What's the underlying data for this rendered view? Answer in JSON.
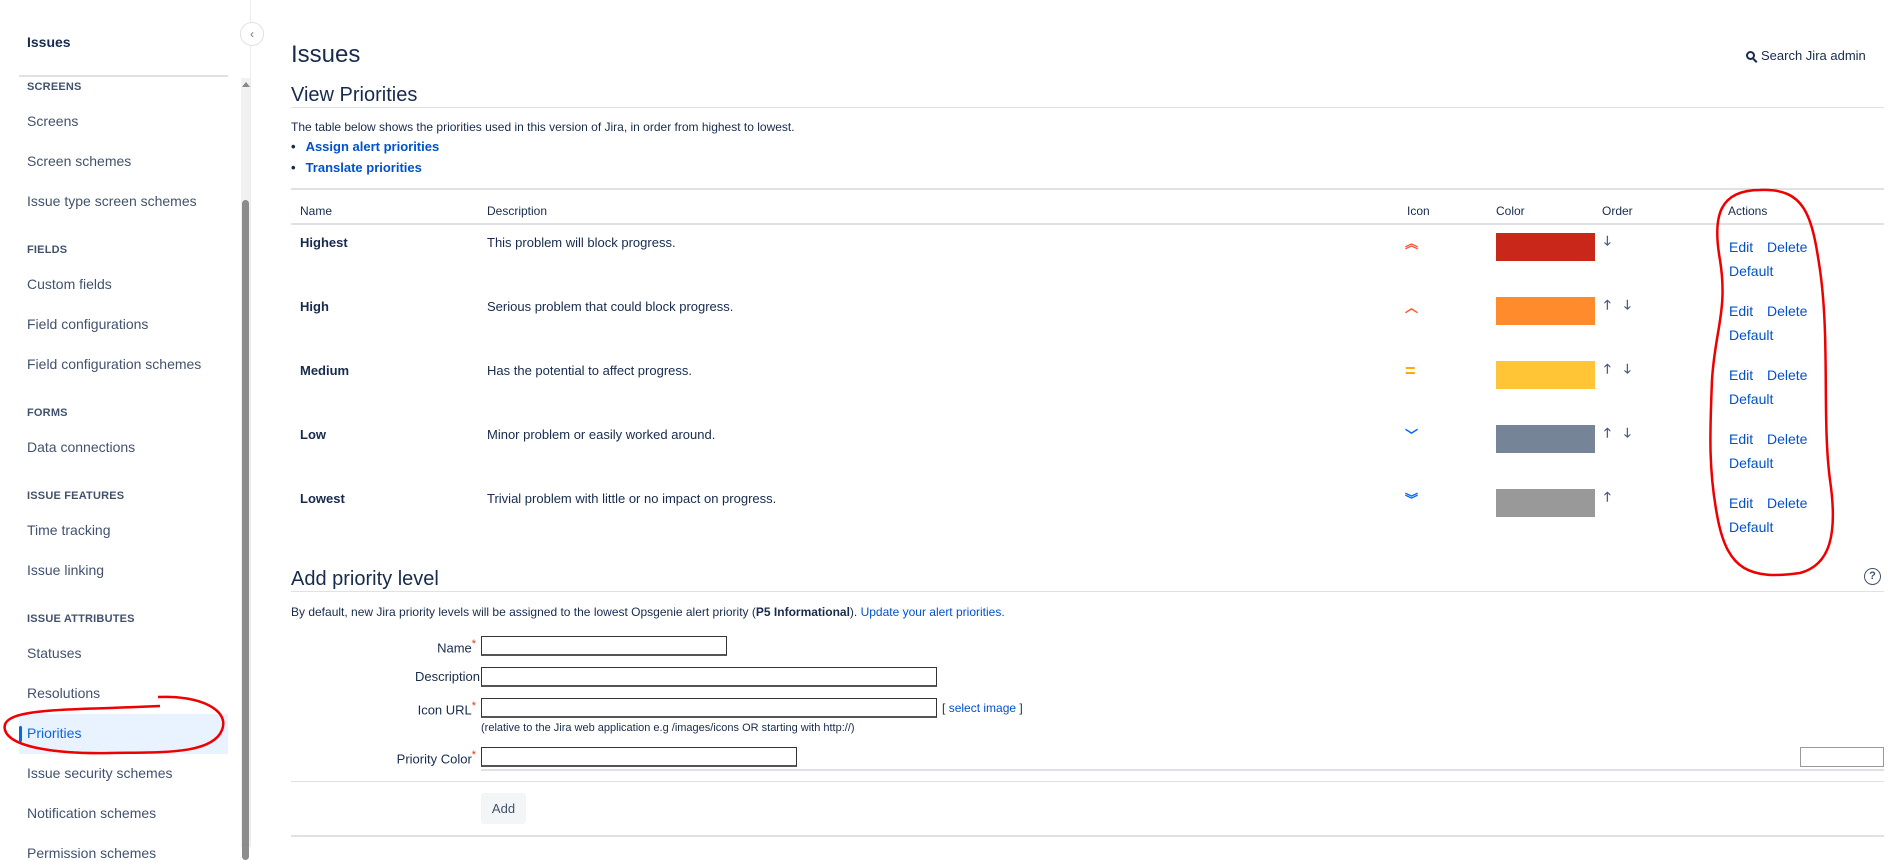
{
  "sidebar": {
    "title": "Issues",
    "sections": [
      {
        "heading": "SCREENS",
        "items": [
          "Screens",
          "Screen schemes",
          "Issue type screen schemes"
        ]
      },
      {
        "heading": "FIELDS",
        "items": [
          "Custom fields",
          "Field configurations",
          "Field configuration schemes"
        ]
      },
      {
        "heading": "FORMS",
        "items": [
          "Data connections"
        ]
      },
      {
        "heading": "ISSUE FEATURES",
        "items": [
          "Time tracking",
          "Issue linking"
        ]
      },
      {
        "heading": "ISSUE ATTRIBUTES",
        "items": [
          "Statuses",
          "Resolutions",
          "Priorities",
          "Issue security schemes",
          "Notification schemes",
          "Permission schemes"
        ]
      }
    ],
    "active": "Priorities"
  },
  "header": {
    "title": "Issues",
    "search_label": "Search Jira admin"
  },
  "view": {
    "title": "View Priorities",
    "intro": "The table below shows the priorities used in this version of Jira, in order from highest to lowest.",
    "links": [
      "Assign alert priorities",
      "Translate priorities"
    ],
    "columns": [
      "Name",
      "Description",
      "Icon",
      "Color",
      "Order",
      "Actions"
    ],
    "rows": [
      {
        "name": "Highest",
        "description": "This problem will block progress.",
        "icon": "double-chevron-up",
        "icon_color": "#ff5630",
        "color": "#c9271a",
        "up": false,
        "down": true
      },
      {
        "name": "High",
        "description": "Serious problem that could block progress.",
        "icon": "chevron-up",
        "icon_color": "#ff5630",
        "color": "#ff8b2d",
        "up": true,
        "down": true
      },
      {
        "name": "Medium",
        "description": "Has the potential to affect progress.",
        "icon": "equals",
        "icon_color": "#ffab00",
        "color": "#ffc536",
        "up": true,
        "down": true
      },
      {
        "name": "Low",
        "description": "Minor problem or easily worked around.",
        "icon": "chevron-down",
        "icon_color": "#0065ff",
        "color": "#768497",
        "up": true,
        "down": true
      },
      {
        "name": "Lowest",
        "description": "Trivial problem with little or no impact on progress.",
        "icon": "double-chevron-down",
        "icon_color": "#0065ff",
        "color": "#999999",
        "up": true,
        "down": false
      }
    ],
    "actions": {
      "edit": "Edit",
      "delete": "Delete",
      "default": "Default"
    },
    "arrows": {
      "up": "🡑",
      "down": "🡓"
    }
  },
  "add": {
    "title": "Add priority level",
    "note_prefix": "By default, new Jira priority levels will be assigned to the lowest Opsgenie alert priority (",
    "note_bold": "P5 Informational",
    "note_suffix": ").",
    "note_link": "Update your alert priorities.",
    "fields": {
      "name": "Name",
      "description": "Description",
      "icon_url": "Icon URL",
      "priority_color": "Priority Color"
    },
    "required_mark": "*",
    "select_image_open": "[",
    "select_image": "select image",
    "select_image_close": "]",
    "icon_hint": "(relative to the Jira web application e.g /images/icons OR starting with http://)",
    "add_button": "Add"
  }
}
